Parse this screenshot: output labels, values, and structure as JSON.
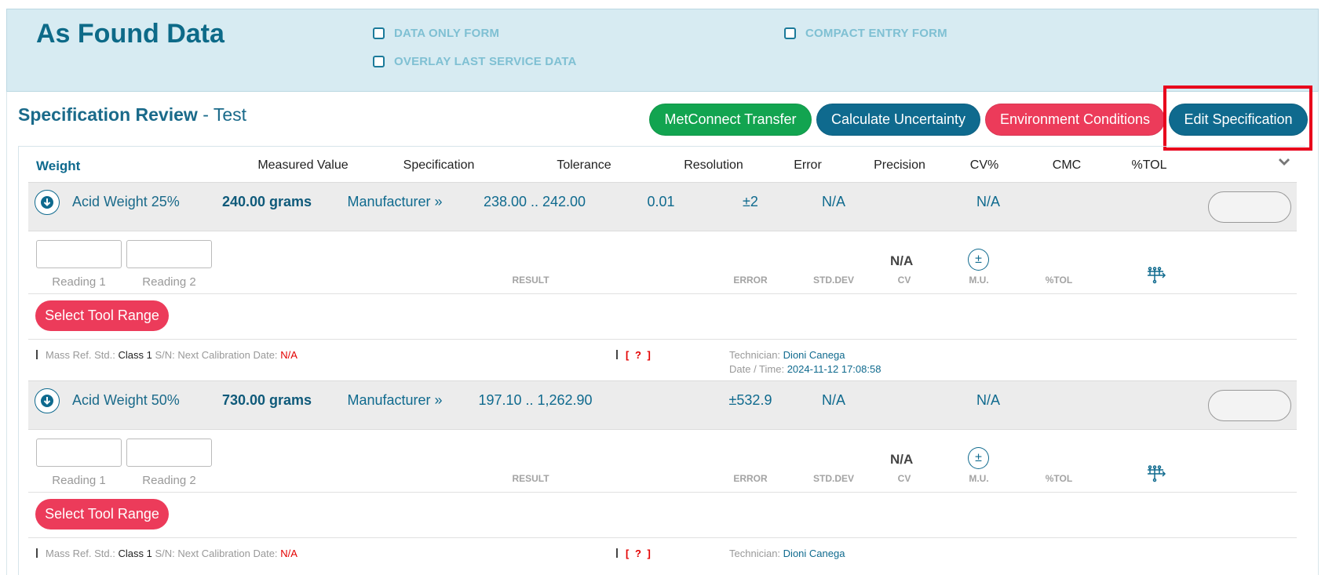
{
  "header": {
    "title": "As Found Data",
    "options": {
      "data_only_form": "DATA ONLY FORM",
      "overlay_last_service": "OVERLAY LAST SERVICE DATA",
      "compact_entry_form": "COMPACT ENTRY FORM"
    }
  },
  "review": {
    "title_bold": "Specification Review",
    "title_rest": " - Test",
    "buttons": {
      "metconnect": "MetConnect Transfer",
      "calc_uncertainty": "Calculate Uncertainty",
      "environment": "Environment Conditions",
      "edit_spec": "Edit Specification"
    }
  },
  "table": {
    "columns": {
      "weight": "Weight",
      "measured": "Measured Value",
      "specification": "Specification",
      "tolerance": "Tolerance",
      "resolution": "Resolution",
      "error": "Error",
      "precision": "Precision",
      "cv": "CV%",
      "cmc": "CMC",
      "tol": "%TOL"
    },
    "entry_labels": {
      "reading1": "Reading 1",
      "reading2": "Reading 2",
      "result": "RESULT",
      "error": "ERROR",
      "stddev": "STD.DEV",
      "cv": "CV",
      "mu": "M.U.",
      "tol": "%TOL",
      "cv_value": "N/A",
      "pm": "±"
    },
    "tool_button": "Select Tool Range",
    "rows": [
      {
        "name": "Acid Weight 25%",
        "measured": "240.00  grams",
        "specification": "Manufacturer »",
        "tolerance": "238.00 .. 242.00",
        "resolution": "0.01",
        "error": "±2",
        "precision": "N/A",
        "cmc": "N/A",
        "info": {
          "mass_ref_label": "Mass Ref. Std.:",
          "mass_ref_value": "Class 1",
          "sn_label": "S/N: Next Calibration Date:",
          "next_cal": "N/A",
          "status": "[ ? ]",
          "tech_label": "Technician:",
          "tech_value": "Dioni Canega",
          "date_label": "Date / Time:",
          "date_value": "2024-11-12 17:08:58"
        }
      },
      {
        "name": "Acid Weight 50%",
        "measured": "730.00  grams",
        "specification": "Manufacturer »",
        "tolerance": "197.10 .. 1,262.90",
        "resolution": "",
        "error": "±532.9",
        "precision": "N/A",
        "cmc": "N/A",
        "info": {
          "mass_ref_label": "Mass Ref. Std.:",
          "mass_ref_value": "Class 1",
          "sn_label": "S/N: Next Calibration Date:",
          "next_cal": "N/A",
          "status": "[ ? ]",
          "tech_label": "Technician:",
          "tech_value": "Dioni Canega"
        }
      }
    ]
  }
}
